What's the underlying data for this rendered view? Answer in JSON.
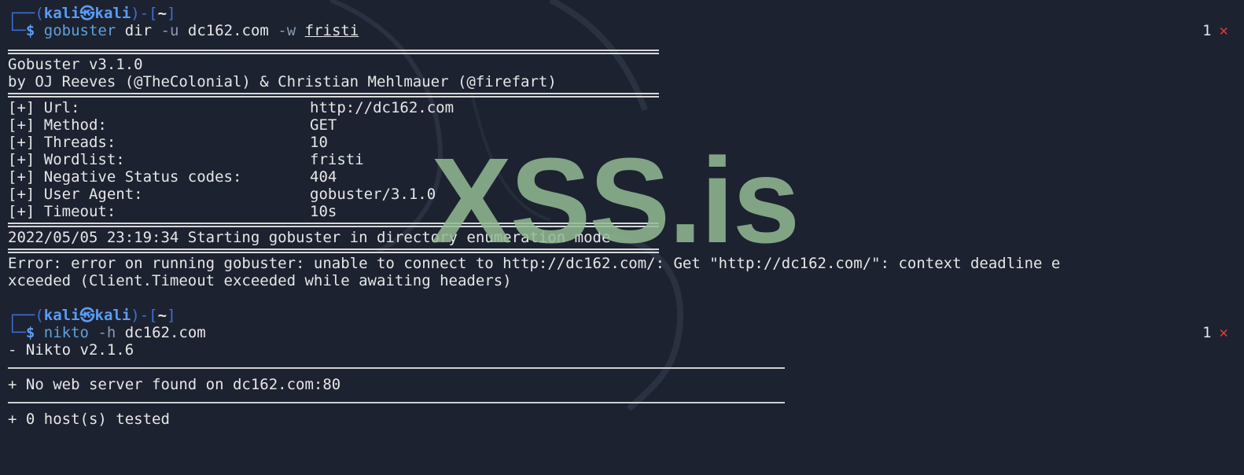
{
  "prompt1": {
    "top": "┌──(",
    "user": "kali㉿kali",
    "mid": ")-[",
    "dir": "~",
    "end": "]",
    "corner": "└─",
    "dollar": "$",
    "cmd": "gobuster",
    "a1": "dir",
    "f1": "-u",
    "a2": "dc162.com",
    "f2": "-w",
    "a3": "fristi",
    "status_num": "1",
    "status_icon": "✕"
  },
  "gobuster": {
    "title": "Gobuster v3.1.0",
    "authors": "by OJ Reeves (@TheColonial) & Christian Mehlmauer (@firefart)",
    "options": [
      {
        "k": "[+] Url:",
        "v": "http://dc162.com"
      },
      {
        "k": "[+] Method:",
        "v": "GET"
      },
      {
        "k": "[+] Threads:",
        "v": "10"
      },
      {
        "k": "[+] Wordlist:",
        "v": "fristi"
      },
      {
        "k": "[+] Negative Status codes:",
        "v": "404"
      },
      {
        "k": "[+] User Agent:",
        "v": "gobuster/3.1.0"
      },
      {
        "k": "[+] Timeout:",
        "v": "10s"
      }
    ],
    "start": "2022/05/05 23:19:34 Starting gobuster in directory enumeration mode",
    "error1": "Error: error on running gobuster: unable to connect to http://dc162.com/: Get \"http://dc162.com/\": context deadline e",
    "error2": "xceeded (Client.Timeout exceeded while awaiting headers)"
  },
  "prompt2": {
    "cmd": "nikto",
    "f1": "-h",
    "a1": "dc162.com",
    "status_num": "1",
    "status_icon": "✕"
  },
  "nikto": {
    "version": "- Nikto v2.1.6",
    "result": "+ No web server found on dc162.com:80",
    "tested": "+ 0 host(s) tested"
  },
  "watermark": "XSS.is",
  "colors": {
    "background": "#1c2230",
    "prompt_blue": "#3d6fd6",
    "error_red": "#e03a3a",
    "watermark_green": "#93bb93"
  }
}
